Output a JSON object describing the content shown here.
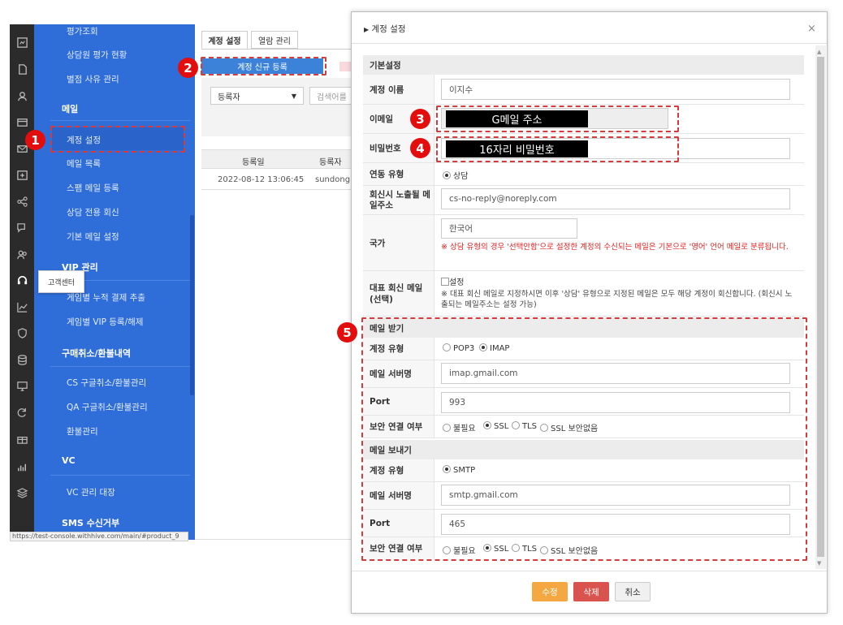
{
  "sidebar": {
    "items": {
      "eval_inquiry": "평가조회",
      "agent_eval": "상담원 평가 현황",
      "low_score": "별점 사유 관리",
      "mail_header": "메일",
      "account_settings": "계정 설정",
      "mail_list": "메일 목록",
      "spam_register": "스팸 메일 등록",
      "dedicated_reply": "상담 전용 회신",
      "default_mail": "기본 메일 설정",
      "vip_header": "VIP 관리",
      "cumulative_pay": "게임별 누적 결제 추출",
      "vip_register": "게임별 VIP 등록/해제",
      "refund_header": "구매취소/환불내역",
      "cs_refund": "CS 구글취소/환불관리",
      "qa_refund": "QA 구글취소/환불관리",
      "refund_manage": "환불관리",
      "vc_header": "VC",
      "vc_manage": "VC 관리 대장",
      "sms_header": "SMS 수신거부"
    },
    "tooltip": "고객센터",
    "status_url": "https://test-console.withhive.com/main/#product_9"
  },
  "main": {
    "tabs": [
      "계정 설정",
      "열람 관리"
    ],
    "new_button": "계정 신규 등록",
    "filter_select": "등록자",
    "search_placeholder": "검색어를",
    "table": {
      "headers": [
        "등록일",
        "등록자"
      ],
      "rows": [
        [
          "2022-08-12 13:06:45",
          "sundong"
        ]
      ]
    }
  },
  "modal": {
    "title": "계정 설정",
    "basic_section": "기본설정",
    "labels": {
      "account_name": "계정 이름",
      "email": "이메일",
      "password": "비밀번호",
      "link_type": "연동 유형",
      "reply_addr": "회신시 노출될 메일주소",
      "country": "국가",
      "rep_reply": "대표 회신 메일 (선택)"
    },
    "values": {
      "account_name": "이지수",
      "email_mask": "G메일 주소",
      "password_mask": "16자리 비밀번호",
      "link_type": "상담",
      "reply_addr": "cs-no-reply@noreply.com",
      "country": "한국어",
      "country_note": "※ 상담 유형의 경우 '선택안함'으로 설정한 계정의 수신되는 메일은 기본으로 '영어' 언어 메일로 분류됩니다.",
      "rep_checkbox": "설정",
      "rep_note": "※ 대표 회신 메일로 지정하시면 이후 '상담' 유형으로 지정된 메일은 모두 해당 계정이 회신합니다. (회신시 노출되는 메일주소는 설정 가능)"
    },
    "receive": {
      "section": "메일 받기",
      "account_type_label": "계정 유형",
      "types": [
        "POP3",
        "IMAP"
      ],
      "selected_type": "IMAP",
      "server_label": "메일 서버명",
      "server": "imap.gmail.com",
      "port_label": "Port",
      "port": "993",
      "security_label": "보안 연결 여부",
      "security_options": [
        "불필요",
        "SSL",
        "TLS",
        "SSL 보안없음"
      ],
      "security_selected": "SSL"
    },
    "send": {
      "section": "메일 보내기",
      "account_type_label": "계정 유형",
      "type": "SMTP",
      "server_label": "메일 서버명",
      "server": "smtp.gmail.com",
      "port_label": "Port",
      "port": "465",
      "security_label": "보안 연결 여부",
      "security_options": [
        "불필요",
        "SSL",
        "TLS",
        "SSL 보안없음"
      ],
      "security_selected": "SSL"
    },
    "buttons": {
      "edit": "수정",
      "delete": "삭제",
      "cancel": "취소"
    },
    "colors": {
      "edit": "#f5a742",
      "delete": "#d9534f",
      "cancel": "#f0f0f0"
    }
  },
  "annotations": [
    "1",
    "2",
    "3",
    "4",
    "5"
  ],
  "colors": {
    "sidebar": "#2f6ed8",
    "iconbar": "#2b2b2b",
    "highlight": "#d63a3a",
    "primary_button": "#3b82d8"
  }
}
